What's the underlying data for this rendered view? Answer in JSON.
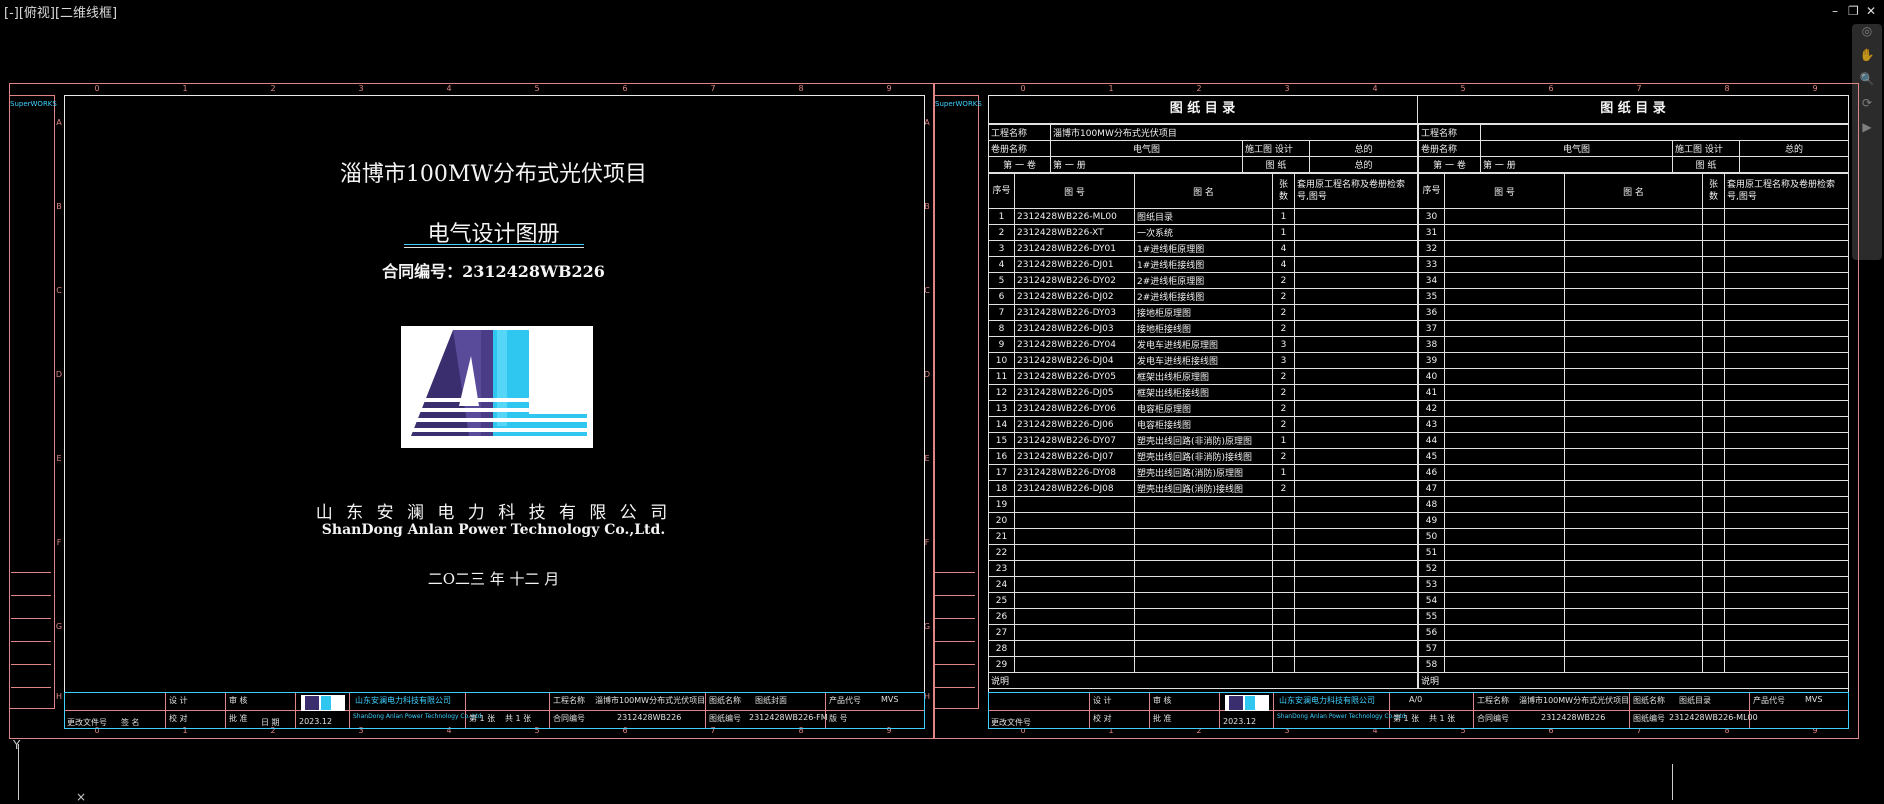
{
  "viewport": {
    "label": "[-][俯视][二维线框]"
  },
  "window_controls": {
    "minimize": "–",
    "restore": "❐",
    "close": "✕"
  },
  "cover": {
    "brand": "SuperWORKS",
    "project_title": "淄博市100MW分布式光伏项目",
    "album_title": "电气设计图册",
    "contract": "合同编号：2312428WB226",
    "company_cn": "山 东 安 澜 电 力 科 技 有 限 公 司",
    "company_en": "ShanDong Anlan Power Technology Co.,Ltd.",
    "date": "二O二三 年 十二 月",
    "title_block": {
      "company_cn": "山东安澜电力科技有限公司",
      "company_en": "ShanDong Anlan Power Technology Co.,Ltd.",
      "project_label": "工程名称",
      "project_name": "淄博市100MW分布式光伏项目",
      "contract_label": "合同编号",
      "contract_no": "2312428WB226",
      "drawing_label": "图纸名称",
      "drawing_name": "图纸封面",
      "drawing_no_label": "图纸编号",
      "drawing_no": "2312428WB226-FM",
      "product_label": "产品代号",
      "product_code": "MVS",
      "date_label": "日 期",
      "date": "2023.12",
      "sheet_label": "第 1 张",
      "sheet_total": "共 1 张",
      "design": "设 计",
      "check": "校 对",
      "review": "审 核",
      "approve": "批 准",
      "revision": "更改文件号",
      "sign": "签 名",
      "version": "版 号"
    }
  },
  "index_sheet": {
    "heading_left": "图 纸 目 录",
    "heading_right": "图 纸 目 录",
    "project_label": "工程名称",
    "project_name": "淄博市100MW分布式光伏项目",
    "volume_label": "卷册名称",
    "volume_name": "电气图",
    "stage_label": "施工图 设计",
    "total_label": "总的",
    "vol_no": "第 一 卷",
    "book_no": "第 一 册",
    "drawings_label": "图 纸",
    "col_seq": "序号",
    "col_no": "图 号",
    "col_name": "图 名",
    "col_sheets": "张数",
    "col_reuse": "套用原工程名称及卷册检索号,图号",
    "note_label": "说明",
    "rows_left": [
      {
        "seq": "1",
        "no": "2312428WB226-ML00",
        "name": "图纸目录",
        "sheets": "1"
      },
      {
        "seq": "2",
        "no": "2312428WB226-XT",
        "name": "一次系统",
        "sheets": "1"
      },
      {
        "seq": "3",
        "no": "2312428WB226-DY01",
        "name": "1#进线柜原理图",
        "sheets": "4"
      },
      {
        "seq": "4",
        "no": "2312428WB226-DJ01",
        "name": "1#进线柜接线图",
        "sheets": "4"
      },
      {
        "seq": "5",
        "no": "2312428WB226-DY02",
        "name": "2#进线柜原理图",
        "sheets": "2"
      },
      {
        "seq": "6",
        "no": "2312428WB226-DJ02",
        "name": "2#进线柜接线图",
        "sheets": "2"
      },
      {
        "seq": "7",
        "no": "2312428WB226-DY03",
        "name": "接地柜原理图",
        "sheets": "2"
      },
      {
        "seq": "8",
        "no": "2312428WB226-DJ03",
        "name": "接地柜接线图",
        "sheets": "2"
      },
      {
        "seq": "9",
        "no": "2312428WB226-DY04",
        "name": "发电车进线柜原理图",
        "sheets": "3"
      },
      {
        "seq": "10",
        "no": "2312428WB226-DJ04",
        "name": "发电车进线柜接线图",
        "sheets": "3"
      },
      {
        "seq": "11",
        "no": "2312428WB226-DY05",
        "name": "框架出线柜原理图",
        "sheets": "2"
      },
      {
        "seq": "12",
        "no": "2312428WB226-DJ05",
        "name": "框架出线柜接线图",
        "sheets": "2"
      },
      {
        "seq": "13",
        "no": "2312428WB226-DY06",
        "name": "电容柜原理图",
        "sheets": "2"
      },
      {
        "seq": "14",
        "no": "2312428WB226-DJ06",
        "name": "电容柜接线图",
        "sheets": "2"
      },
      {
        "seq": "15",
        "no": "2312428WB226-DY07",
        "name": "塑壳出线回路(非消防)原理图",
        "sheets": "1"
      },
      {
        "seq": "16",
        "no": "2312428WB226-DJ07",
        "name": "塑壳出线回路(非消防)接线图",
        "sheets": "2"
      },
      {
        "seq": "17",
        "no": "2312428WB226-DY08",
        "name": "塑壳出线回路(消防)原理图",
        "sheets": "1"
      },
      {
        "seq": "18",
        "no": "2312428WB226-DJ08",
        "name": "塑壳出线回路(消防)接线图",
        "sheets": "2"
      },
      {
        "seq": "19",
        "no": "",
        "name": "",
        "sheets": ""
      },
      {
        "seq": "20",
        "no": "",
        "name": "",
        "sheets": ""
      },
      {
        "seq": "21",
        "no": "",
        "name": "",
        "sheets": ""
      },
      {
        "seq": "22",
        "no": "",
        "name": "",
        "sheets": ""
      },
      {
        "seq": "23",
        "no": "",
        "name": "",
        "sheets": ""
      },
      {
        "seq": "24",
        "no": "",
        "name": "",
        "sheets": ""
      },
      {
        "seq": "25",
        "no": "",
        "name": "",
        "sheets": ""
      },
      {
        "seq": "26",
        "no": "",
        "name": "",
        "sheets": ""
      },
      {
        "seq": "27",
        "no": "",
        "name": "",
        "sheets": ""
      },
      {
        "seq": "28",
        "no": "",
        "name": "",
        "sheets": ""
      },
      {
        "seq": "29",
        "no": "",
        "name": "",
        "sheets": ""
      }
    ],
    "rows_right": [
      "30",
      "31",
      "32",
      "33",
      "34",
      "35",
      "36",
      "37",
      "38",
      "39",
      "40",
      "41",
      "42",
      "43",
      "44",
      "45",
      "46",
      "47",
      "48",
      "49",
      "50",
      "51",
      "52",
      "53",
      "54",
      "55",
      "56",
      "57",
      "58"
    ],
    "title_block": {
      "company_cn": "山东安澜电力科技有限公司",
      "company_en": "ShanDong Anlan Power Technology Co.,Ltd.",
      "project_label": "工程名称",
      "project_name": "淄博市100MW分布式光伏项目",
      "contract_label": "合同编号",
      "contract_no": "2312428WB226",
      "drawing_label": "图纸名称",
      "drawing_name": "图纸目录",
      "drawing_no_label": "图纸编号",
      "drawing_no": "2312428WB226-ML00",
      "product_label": "产品代号",
      "product_code": "MVS",
      "size": "A/0",
      "date": "2023.12",
      "sheet_label": "第 1 张",
      "sheet_total": "共 1 张"
    }
  },
  "ruler_numbers": [
    "0",
    "1",
    "2",
    "3",
    "4",
    "5",
    "6",
    "7",
    "8",
    "9"
  ],
  "ruler_letters": [
    "A",
    "B",
    "C",
    "D",
    "E",
    "F",
    "G",
    "H"
  ],
  "logo": {
    "text": "AL"
  }
}
